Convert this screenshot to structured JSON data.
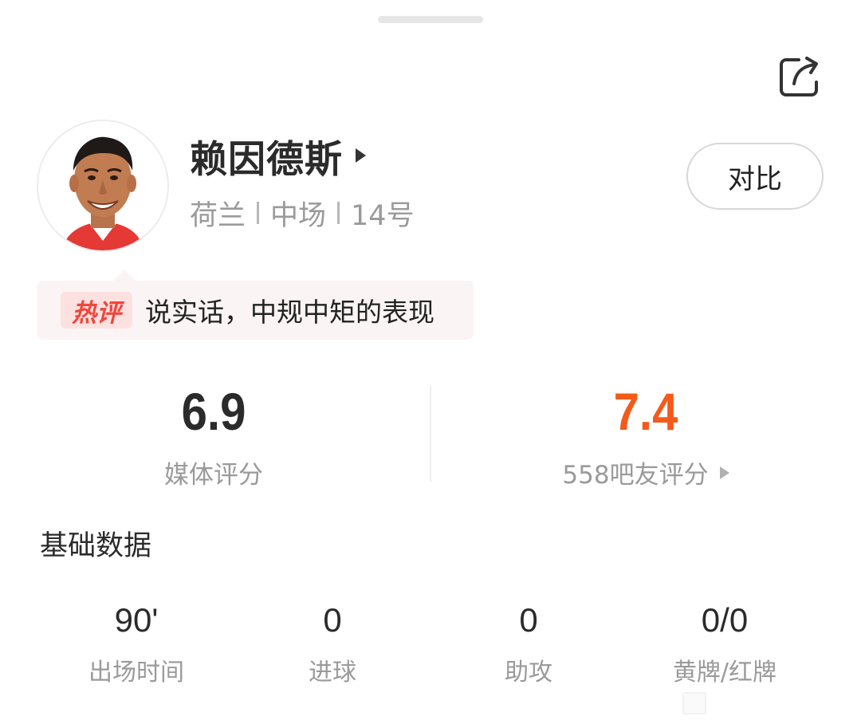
{
  "share": {
    "icon": "share-icon"
  },
  "player": {
    "name": "赖因德斯",
    "country": "荷兰",
    "position": "中场",
    "number": "14号",
    "compare_label": "对比"
  },
  "hot_comment": {
    "badge": "热评",
    "text": "说实话，中规中矩的表现"
  },
  "ratings": {
    "media": {
      "value": "6.9",
      "label": "媒体评分"
    },
    "fans": {
      "value": "7.4",
      "label": "558吧友评分"
    }
  },
  "basic_stats": {
    "title": "基础数据",
    "items": [
      {
        "value": "90'",
        "label": "出场时间"
      },
      {
        "value": "0",
        "label": "进球"
      },
      {
        "value": "0",
        "label": "助攻"
      },
      {
        "value": "0/0",
        "label": "黄牌/红牌"
      }
    ]
  },
  "colors": {
    "accent_orange": "#f45a1a",
    "hot_red": "#f0463c",
    "muted_text": "#9a9a9a"
  }
}
